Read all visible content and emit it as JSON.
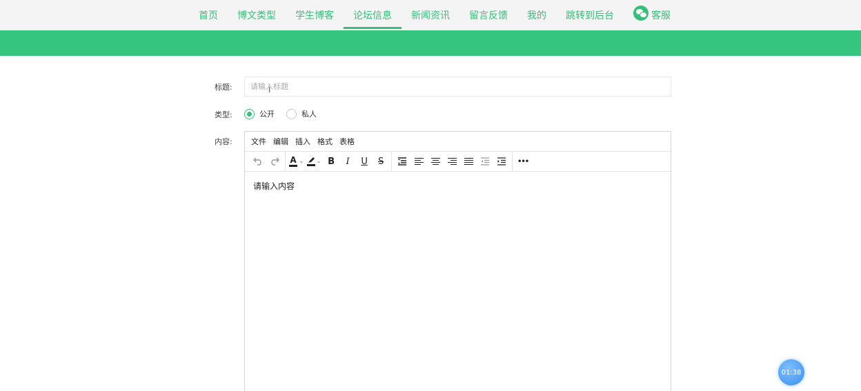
{
  "nav": {
    "items": [
      {
        "label": "首页",
        "active": false
      },
      {
        "label": "博文类型",
        "active": false
      },
      {
        "label": "学生博客",
        "active": false
      },
      {
        "label": "论坛信息",
        "active": true
      },
      {
        "label": "新闻资讯",
        "active": false
      },
      {
        "label": "留言反馈",
        "active": false
      },
      {
        "label": "我的",
        "active": false
      },
      {
        "label": "跳转到后台",
        "active": false
      }
    ],
    "service": {
      "label": "客服",
      "icon": "wechat-icon"
    }
  },
  "colors": {
    "accent": "#36bf7a",
    "banner": "#36c57f",
    "timer": "#3b8ff0"
  },
  "form": {
    "title_label": "标题:",
    "title_placeholder": "请输入标题",
    "type_label": "类型:",
    "type_options": [
      {
        "label": "公开",
        "checked": true
      },
      {
        "label": "私人",
        "checked": false
      }
    ],
    "content_label": "内容:"
  },
  "editor": {
    "menu": [
      "文件",
      "编辑",
      "插入",
      "格式",
      "表格"
    ],
    "tools": {
      "undo": "undo-icon",
      "redo": "redo-icon",
      "text_color": "text-color-icon",
      "highlight": "highlight-icon",
      "bold": "B",
      "italic": "I",
      "underline": "U",
      "strike": "S",
      "more": "•••"
    },
    "content": "请输入内容"
  },
  "timer": {
    "text": "01:38"
  }
}
